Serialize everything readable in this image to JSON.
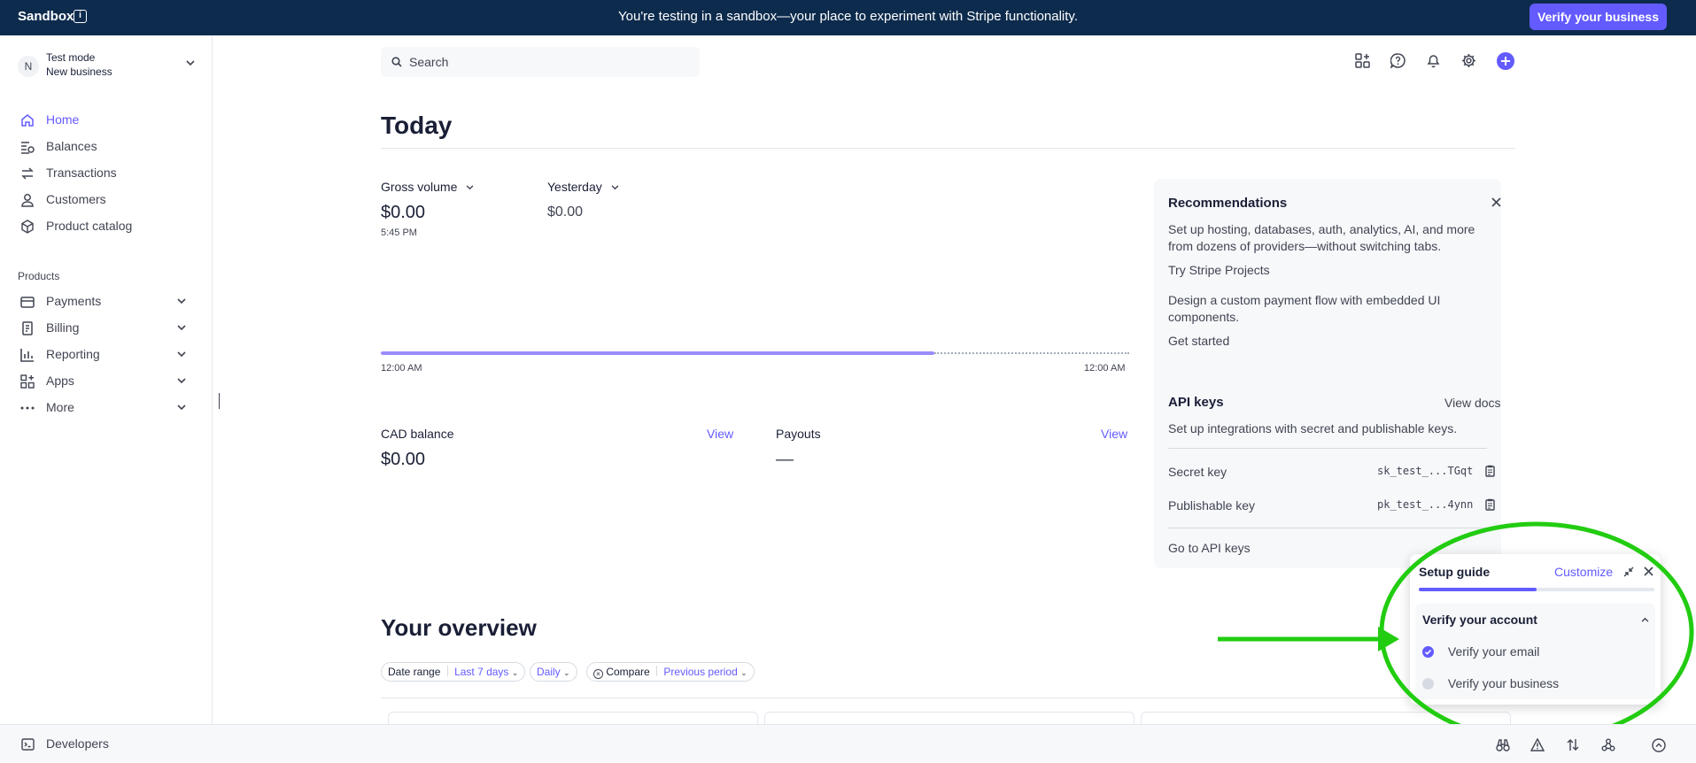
{
  "banner": {
    "sandbox_label": "Sandbox",
    "message": "You're testing in a sandbox—your place to experiment with Stripe functionality.",
    "verify_button": "Verify your business"
  },
  "account": {
    "avatar_initial": "N",
    "mode": "Test mode",
    "business": "New business"
  },
  "sidebar": {
    "items": [
      {
        "label": "Home",
        "icon": "home-icon",
        "active": true
      },
      {
        "label": "Balances",
        "icon": "balances-icon"
      },
      {
        "label": "Transactions",
        "icon": "transactions-icon"
      },
      {
        "label": "Customers",
        "icon": "person-icon"
      },
      {
        "label": "Product catalog",
        "icon": "box-icon"
      }
    ],
    "products_label": "Products",
    "products": [
      {
        "label": "Payments",
        "icon": "wallet-icon"
      },
      {
        "label": "Billing",
        "icon": "billing-icon"
      },
      {
        "label": "Reporting",
        "icon": "chart-icon"
      },
      {
        "label": "Apps",
        "icon": "apps-icon"
      },
      {
        "label": "More",
        "icon": "more-icon"
      }
    ]
  },
  "bottom_bar": {
    "developers_label": "Developers"
  },
  "header": {
    "search_placeholder": "Search"
  },
  "today": {
    "title": "Today",
    "gross_volume_label": "Gross volume",
    "gross_volume_value": "$0.00",
    "gross_volume_time": "5:45 PM",
    "yesterday_label": "Yesterday",
    "yesterday_value": "$0.00",
    "axis_start": "12:00 AM",
    "axis_end": "12:00 AM",
    "progress_fraction": 0.74,
    "balance_label": "CAD balance",
    "balance_value": "$0.00",
    "balance_link": "View",
    "payouts_label": "Payouts",
    "payouts_value": "—",
    "payouts_link": "View"
  },
  "recommendations": {
    "title": "Recommendations",
    "text1": "Set up hosting, databases, auth, analytics, AI, and more from dozens of providers—without switching tabs.",
    "link1": "Try Stripe Projects",
    "text2": "Design a custom payment flow with embedded UI components.",
    "link2": "Get started"
  },
  "api_keys": {
    "title": "API keys",
    "docs_link": "View docs",
    "description": "Set up integrations with secret and publishable keys.",
    "secret_label": "Secret key",
    "secret_value": "sk_test_...TGqt",
    "publishable_label": "Publishable key",
    "publishable_value": "pk_test_...4ynn",
    "go_link": "Go to API keys"
  },
  "overview": {
    "title": "Your overview",
    "date_range_label": "Date range",
    "date_range_value": "Last 7 days",
    "interval": "Daily",
    "compare_label": "Compare",
    "compare_value": "Previous period"
  },
  "setup_guide": {
    "title": "Setup guide",
    "customize": "Customize",
    "progress_fraction": 0.5,
    "section_title": "Verify your account",
    "tasks": [
      {
        "label": "Verify your email",
        "done": true
      },
      {
        "label": "Verify your business",
        "done": false
      }
    ]
  },
  "colors": {
    "accent": "#635bff",
    "banner_bg": "#0d2b4d",
    "annotation": "#22cc11"
  }
}
